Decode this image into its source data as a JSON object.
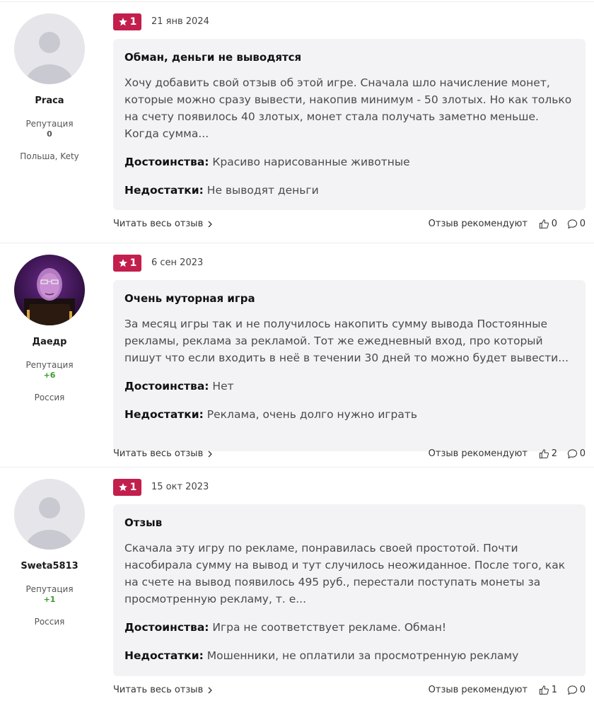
{
  "accent_color": "#c21f4c",
  "reviews": [
    {
      "user": {
        "name": "Praca",
        "reputation_label": "Репутация",
        "reputation": "0",
        "location": "Польша, Kety",
        "avatar": "default-avatar"
      },
      "rating": "1",
      "date": "21 янв 2024",
      "title": "Обман, деньги не выводятся",
      "text": "Хочу добавить свой отзыв об этой игре. Сначала шло начисление монет, которые можно сразу вывести, накопив минимум - 50 злотых. Но как только на счету появилось 40 злотых, монет стала получать заметно меньше. Когда сумма...",
      "pros_label": "Достоинства:",
      "pros": "Красиво нарисованные животные",
      "cons_label": "Недостатки:",
      "cons": "Не выводят деньги",
      "read_more": "Читать весь отзыв",
      "recommend": "Отзыв рекомендуют",
      "likes": "0",
      "comments": "0"
    },
    {
      "user": {
        "name": "Даедр",
        "reputation_label": "Репутация",
        "reputation": "+6",
        "location": "Россия",
        "avatar": "illustrated-avatar"
      },
      "rating": "1",
      "date": "6 сен 2023",
      "title": "Очень муторная игра",
      "text": "За месяц игры так и не получилось накопить сумму вывода Постоянные рекламы, реклама за рекламой. Тот же ежедневный вход, про который пишут что если входить в неё в течении 30 дней то можно будет вывести...",
      "pros_label": "Достоинства:",
      "pros": "Нет",
      "cons_label": "Недостатки:",
      "cons": "Реклама, очень долго нужно играть",
      "read_more": "Читать весь отзыв",
      "recommend": "Отзыв рекомендуют",
      "likes": "2",
      "comments": "0"
    },
    {
      "user": {
        "name": "Sweta5813",
        "reputation_label": "Репутация",
        "reputation": "+1",
        "location": "Россия",
        "avatar": "default-avatar"
      },
      "rating": "1",
      "date": "15 окт 2023",
      "title": "Отзыв",
      "text": "Скачала эту игру по рекламе, понравилась своей простотой. Почти насобирала сумму на вывод и тут случилось неожиданное. После того, как на счете на вывод появилось 495 руб., перестали поступать монеты за просмотренную рекламу, т. е...",
      "pros_label": "Достоинства:",
      "pros": "Игра не соответствует рекламе. Обман!",
      "cons_label": "Недостатки:",
      "cons": "Мошенники, не оплатили за просмотренную рекламу",
      "read_more": "Читать весь отзыв",
      "recommend": "Отзыв рекомендуют",
      "likes": "1",
      "comments": "0"
    }
  ]
}
